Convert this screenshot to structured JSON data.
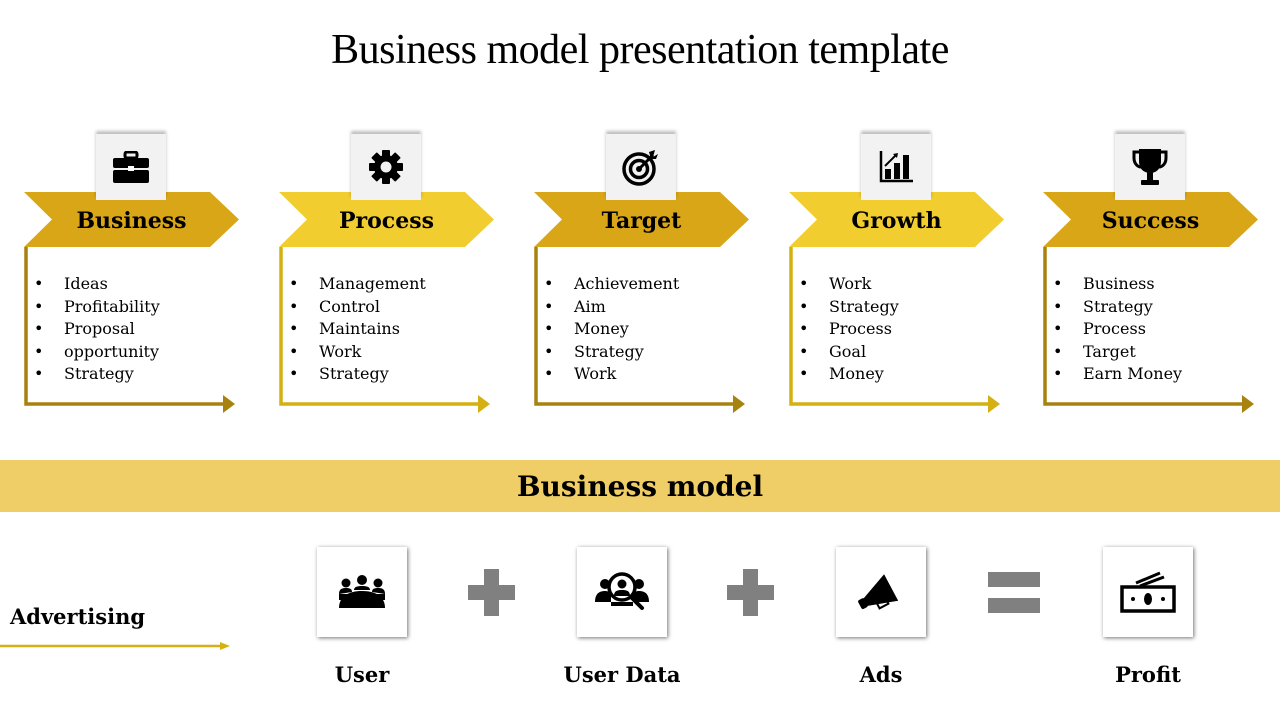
{
  "title": "Business model presentation template",
  "colors": {
    "dark_gold": "#d8a617",
    "bright_gold": "#f2cd30",
    "dark_line": "#a8820f",
    "bright_line": "#d4b012",
    "band": "#f0ce67",
    "operator_gray": "#808080",
    "icon_tile": "#f2f2f2"
  },
  "stages": [
    {
      "label": "Business",
      "icon": "briefcase-icon",
      "tone": "dark",
      "items": [
        "Ideas",
        "Profitability",
        "Proposal",
        "opportunity",
        "Strategy"
      ]
    },
    {
      "label": "Process",
      "icon": "gear-icon",
      "tone": "bright",
      "items": [
        "Management",
        "Control",
        "Maintains",
        "Work",
        "Strategy"
      ]
    },
    {
      "label": "Target",
      "icon": "target-icon",
      "tone": "dark",
      "items": [
        "Achievement",
        "Aim",
        "Money",
        "Strategy",
        "Work"
      ]
    },
    {
      "label": "Growth",
      "icon": "growth-chart-icon",
      "tone": "bright",
      "items": [
        "Work",
        "Strategy",
        "Process",
        "Goal",
        "Money"
      ]
    },
    {
      "label": "Success",
      "icon": "trophy-icon",
      "tone": "dark",
      "items": [
        "Business",
        "Strategy",
        "Process",
        "Target",
        "Earn Money"
      ]
    }
  ],
  "band_title": "Business model",
  "advertising_label": "Advertising",
  "equation": [
    {
      "label": "User",
      "icon": "group-icon"
    },
    {
      "operator": "plus"
    },
    {
      "label": "User Data",
      "icon": "user-search-icon"
    },
    {
      "operator": "plus"
    },
    {
      "label": "Ads",
      "icon": "megaphone-icon"
    },
    {
      "operator": "equals"
    },
    {
      "label": "Profit",
      "icon": "money-icon"
    }
  ]
}
